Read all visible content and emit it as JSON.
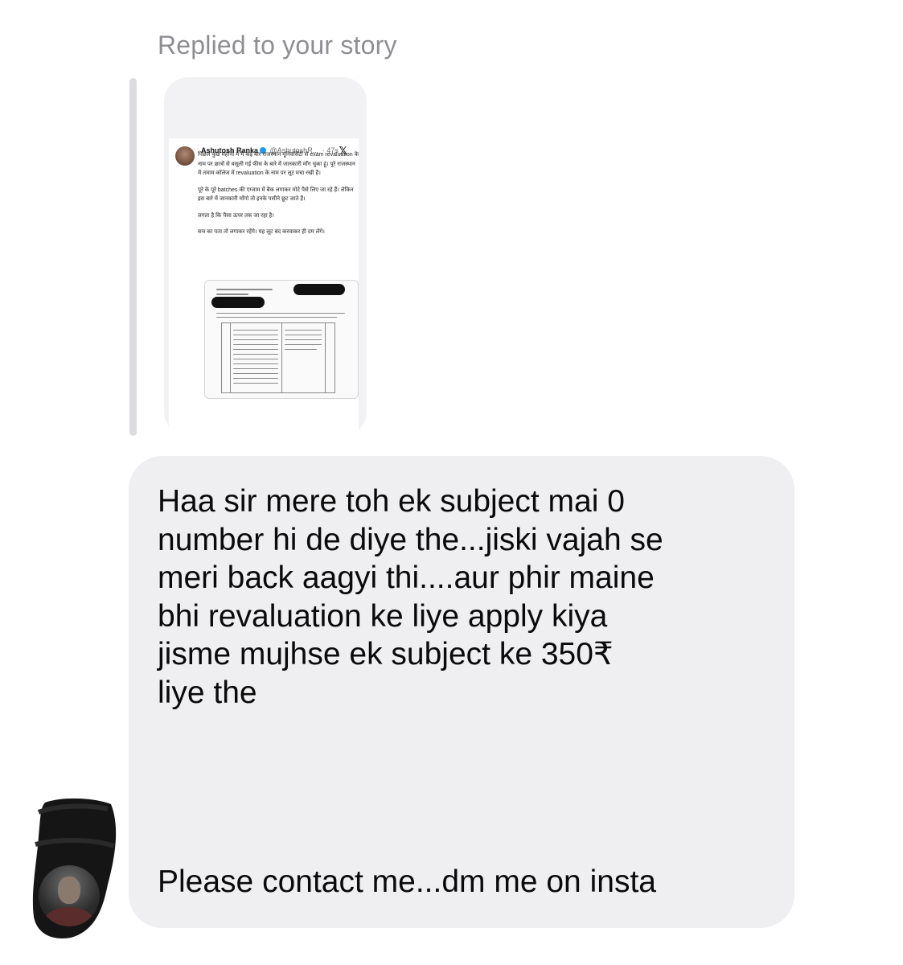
{
  "reply": {
    "header": "Replied to your story"
  },
  "story": {
    "tweet": {
      "author_name": "Ashutosh Ranka",
      "handle": "@AshutoshR...",
      "time": "· 47s",
      "platform_icon": "x-logo-icon",
      "paragraphs": [
        "पिछले कुछ महीनों में मैं कई बार राजस्थान यूनिवर्सिटी से exam revaluation के नाम पर छात्रों से वसूली गई फीस के बारे में जानकारी माँग चुका हूं। पूरे राजस्थान में तमाम कॉलेज में revaluation के नाम पर लूट मचा रखी है।",
        "पूरे के पूरे batches की एग्जाम में बैक लगाकर मोटे पैसे लिए जा रहे हैं। लेकिन इस बारे में जानकारी माँगो तो इनके पसीने छूट जाते हैं।",
        "लगता है कि पैसा ऊपर तक जा रहा है।",
        "सच का पता तो लगाकर रहेंगे। यह लूट बंद करवाकर ही दम लेंगे।"
      ]
    }
  },
  "message": {
    "lines": [
      "Haa sir mere toh ek subject mai 0",
      "number hi de diye the...jiski vajah se",
      "meri back aagyi thi....aur phir maine",
      "bhi revaluation ke liye apply kiya",
      "jisme mujhse ek subject ke 350₹",
      "liye the"
    ],
    "footer": "Please contact me...dm me on insta"
  }
}
